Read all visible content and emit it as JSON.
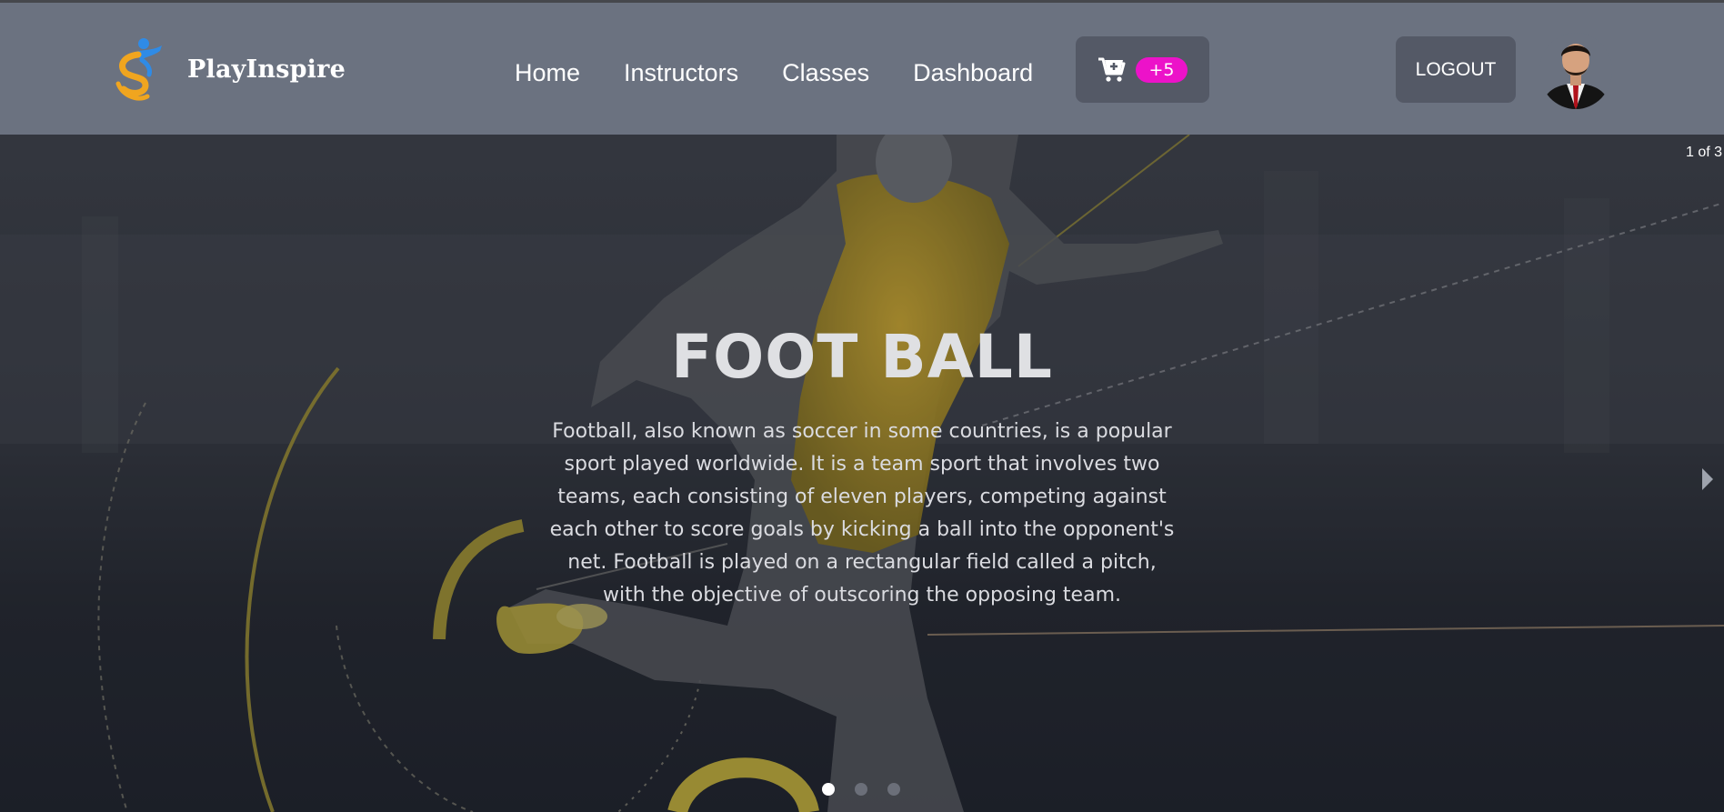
{
  "brand": {
    "name": "PlayInspire",
    "logo_icon": "athlete-logo-icon"
  },
  "nav": {
    "links": [
      {
        "label": "Home"
      },
      {
        "label": "Instructors"
      },
      {
        "label": "Classes"
      },
      {
        "label": "Dashboard"
      }
    ],
    "cart": {
      "icon": "cart-plus-icon",
      "badge": "+5"
    },
    "logout_label": "LOGOUT",
    "avatar_icon": "user-avatar"
  },
  "hero": {
    "counter": "1 of 3",
    "title": "FOOT BALL",
    "description": "Football, also known as soccer in some countries, is a popular sport played worldwide. It is a team sport that involves two teams, each consisting of eleven players, competing against each other to score goals by kicking a ball into the opponent's net. Football is played on a rectangular field called a pitch, with the objective of outscoring the opposing team.",
    "slide_count": 3,
    "active_slide": 1,
    "next_icon": "caret-right-icon"
  },
  "colors": {
    "navbar": "#6b7280",
    "button_bg": "#545966",
    "badge": "#ec12c9",
    "hero_bg": "#22252e",
    "accent_yellow": "#c9b53a"
  }
}
